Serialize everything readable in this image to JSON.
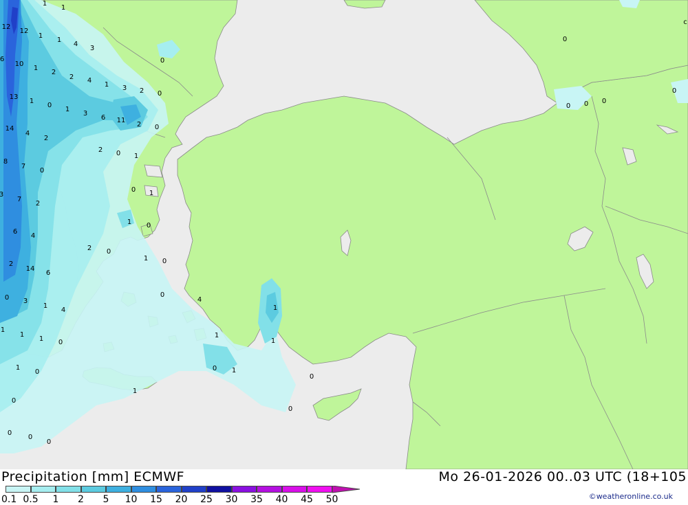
{
  "header": {
    "title": "Precipitation [mm] ECMWF",
    "datetime": "Mo 26-01-2026 00..03 UTC (18+105",
    "credit": "©weatheronline.co.uk"
  },
  "legend": {
    "levels": [
      "0.1",
      "0.5",
      "1",
      "2",
      "5",
      "10",
      "15",
      "20",
      "25",
      "30",
      "35",
      "40",
      "45",
      "50"
    ],
    "colors": [
      "#c8f5f5",
      "#a6eef0",
      "#82e0e8",
      "#5ccbe0",
      "#3eb0e0",
      "#2f8ee0",
      "#2a64dc",
      "#2040c8",
      "#1010a0",
      "#8a10e0",
      "#b410e0",
      "#d810e8",
      "#f010f0",
      "#c010b0"
    ]
  },
  "colors": {
    "land": "#bff59a",
    "sea": "#ececec",
    "border": "#8a8a8a"
  },
  "values": [
    {
      "v": "1"
    },
    {
      "v": "1"
    },
    {
      "v": "12"
    },
    {
      "v": "12"
    },
    {
      "v": "1"
    },
    {
      "v": "1"
    },
    {
      "v": "4"
    },
    {
      "v": "3"
    },
    {
      "v": "0"
    },
    {
      "v": "6"
    },
    {
      "v": "10"
    },
    {
      "v": "1"
    },
    {
      "v": "2"
    },
    {
      "v": "2"
    },
    {
      "v": "4"
    },
    {
      "v": "1"
    },
    {
      "v": "3"
    },
    {
      "v": "2"
    },
    {
      "v": "0"
    },
    {
      "v": "13"
    },
    {
      "v": "1"
    },
    {
      "v": "0"
    },
    {
      "v": "1"
    },
    {
      "v": "3"
    },
    {
      "v": "6"
    },
    {
      "v": "11"
    },
    {
      "v": "2"
    },
    {
      "v": "0"
    },
    {
      "v": "14"
    },
    {
      "v": "4"
    },
    {
      "v": "2"
    },
    {
      "v": "2"
    },
    {
      "v": "0"
    },
    {
      "v": "1"
    },
    {
      "v": "8"
    },
    {
      "v": "7"
    },
    {
      "v": "0"
    },
    {
      "v": "0"
    },
    {
      "v": "1"
    },
    {
      "v": "3"
    },
    {
      "v": "7"
    },
    {
      "v": "2"
    },
    {
      "v": "1"
    },
    {
      "v": "0"
    },
    {
      "v": "6"
    },
    {
      "v": "4"
    },
    {
      "v": "2"
    },
    {
      "v": "0"
    },
    {
      "v": "2"
    },
    {
      "v": "14"
    },
    {
      "v": "6"
    },
    {
      "v": "1"
    },
    {
      "v": "0"
    },
    {
      "v": "0"
    },
    {
      "v": "3"
    },
    {
      "v": "1"
    },
    {
      "v": "4"
    },
    {
      "v": "1"
    },
    {
      "v": "0"
    },
    {
      "v": "4"
    },
    {
      "v": "1"
    },
    {
      "v": "1"
    },
    {
      "v": "1"
    },
    {
      "v": "0"
    },
    {
      "v": "1"
    },
    {
      "v": "1"
    },
    {
      "v": "1"
    },
    {
      "v": "0"
    },
    {
      "v": "1"
    },
    {
      "v": "0"
    },
    {
      "v": "0"
    },
    {
      "v": "1"
    },
    {
      "v": "0"
    },
    {
      "v": "0"
    },
    {
      "v": "0"
    },
    {
      "v": "0"
    },
    {
      "v": "0"
    },
    {
      "v": "0"
    },
    {
      "v": "0"
    },
    {
      "v": "0"
    },
    {
      "v": "0"
    },
    {
      "v": "0"
    },
    {
      "v": "c"
    }
  ]
}
